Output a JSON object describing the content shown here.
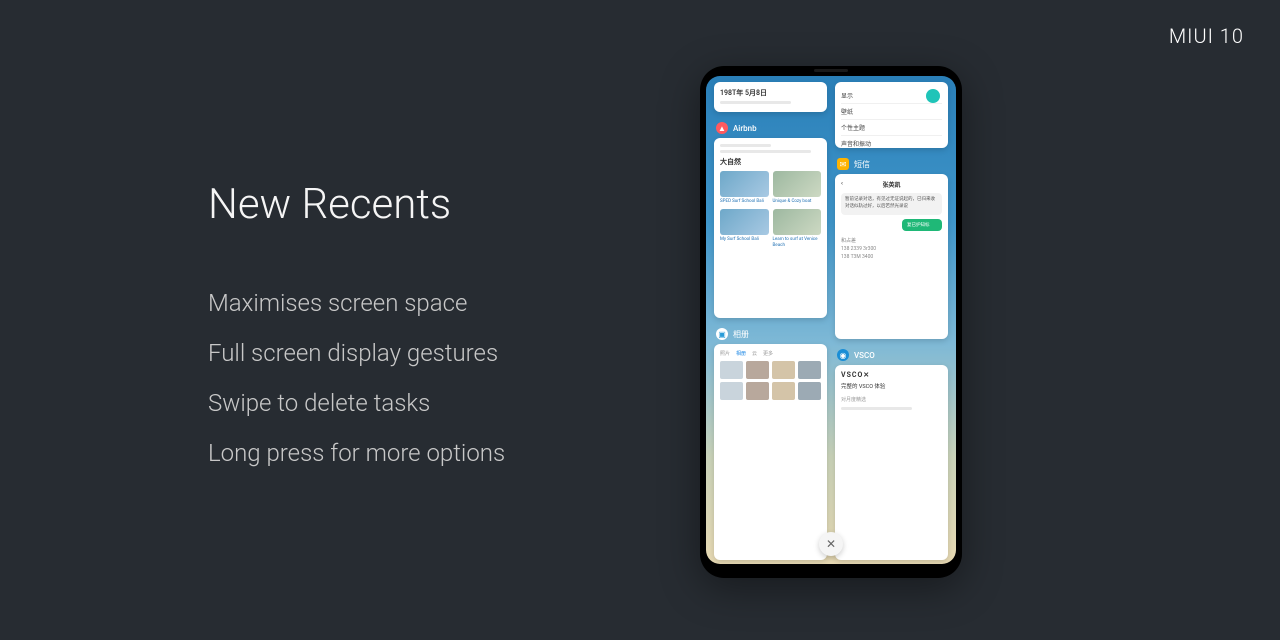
{
  "brand": "MIUI 10",
  "slide": {
    "title": "New Recents",
    "bullets": [
      "Maximises screen space",
      "Full screen display gestures",
      "Swipe to delete tasks",
      "Long press for more options"
    ]
  },
  "phone": {
    "close_label": "✕",
    "left_col": {
      "top_card": {
        "title": "198T年 5月8日"
      },
      "airbnb": {
        "label": "Airbnb",
        "header": "大自然",
        "items": [
          {
            "caption": "SPED Surf School Bali"
          },
          {
            "caption": "Unique & Cozy boat"
          },
          {
            "caption": "My Surf School Bali"
          },
          {
            "caption": "Learn to surf at Venice Beach"
          }
        ]
      },
      "gallery": {
        "label": "相册",
        "tabs": [
          "照片",
          "相册",
          "云",
          "更多"
        ]
      }
    },
    "right_col": {
      "settings": {
        "rows": [
          "显示",
          "壁纸",
          "个性主题",
          "声音和振动"
        ]
      },
      "chat": {
        "label": "短信",
        "contact": "张英凯",
        "msg_in": "暂前记录对话，有见过无证说起的，已归来收对话似轨过好，以后若然光录说",
        "msg_out": "复已护知标",
        "meta1": "和占差",
        "meta2": "138 2339 3r300",
        "meta3": "138 T3M 3400"
      },
      "vsco": {
        "label": "VSCO",
        "logo": "VSCO",
        "subtitle": "完整的 VSCO 体验",
        "line": "对月度精选"
      }
    }
  }
}
